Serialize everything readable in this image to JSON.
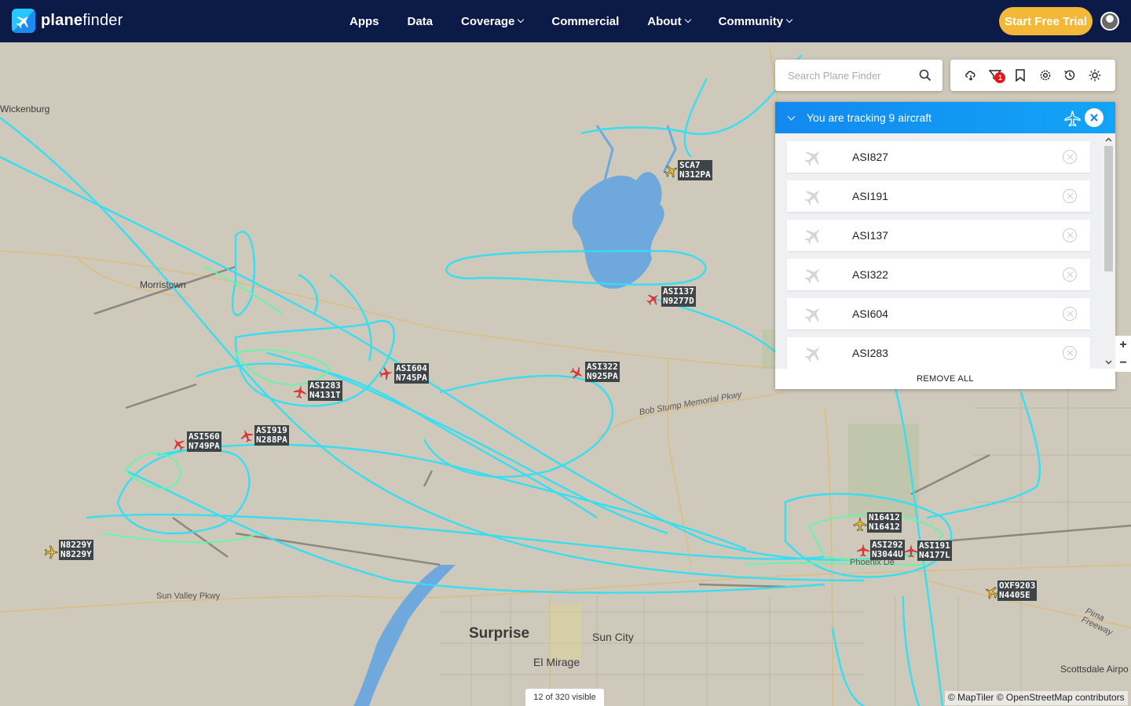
{
  "brand": {
    "name_bold": "plane",
    "name_light": "finder"
  },
  "nav": {
    "items": [
      {
        "label": "Apps",
        "dropdown": false
      },
      {
        "label": "Data",
        "dropdown": false
      },
      {
        "label": "Coverage",
        "dropdown": true
      },
      {
        "label": "Commercial",
        "dropdown": false
      },
      {
        "label": "About",
        "dropdown": true
      },
      {
        "label": "Community",
        "dropdown": true
      }
    ],
    "cta_label": "Start Free Trial"
  },
  "colors": {
    "nav_bg": "#0b1a47",
    "cta": "#f4b838",
    "track": "#2fe0f5",
    "track_alt": "#66f5a8",
    "panel_header": "#1289f0",
    "plane_red": "#d23a3a",
    "plane_yellow": "#f2c21c"
  },
  "search": {
    "placeholder": "Search Plane Finder",
    "icon": "search-icon"
  },
  "toolbar": {
    "icons": [
      "weather-icon",
      "filter-icon",
      "bookmark-icon",
      "settings-icon",
      "history-icon",
      "sun-icon"
    ],
    "filter_badge": "1"
  },
  "tracking": {
    "header": "You are tracking 9 aircraft",
    "remove_all_label": "REMOVE ALL",
    "items": [
      {
        "label": "ASI827"
      },
      {
        "label": "ASI191"
      },
      {
        "label": "ASI137"
      },
      {
        "label": "ASI322"
      },
      {
        "label": "ASI604"
      },
      {
        "label": "ASI283"
      }
    ]
  },
  "aircraft": [
    {
      "line1": "SCA7",
      "line2": "N312PA",
      "color": "yellow"
    },
    {
      "line1": "ASI137",
      "line2": "N9277D",
      "color": "red"
    },
    {
      "line1": "ASI604",
      "line2": "N745PA",
      "color": "red"
    },
    {
      "line1": "ASI322",
      "line2": "N925PA",
      "color": "red"
    },
    {
      "line1": "ASI283",
      "line2": "N4131T",
      "color": "red"
    },
    {
      "line1": "ASI919",
      "line2": "N288PA",
      "color": "red"
    },
    {
      "line1": "ASI560",
      "line2": "N749PA",
      "color": "red"
    },
    {
      "line1": "N8229Y",
      "line2": "N8229Y",
      "color": "yellow"
    },
    {
      "line1": "N16412",
      "line2": "N16412",
      "color": "yellow"
    },
    {
      "line1": "ASI292",
      "line2": "N3044U",
      "color": "red"
    },
    {
      "line1": "ASI191",
      "line2": "N4177L",
      "color": "red"
    },
    {
      "line1": "OXF9203",
      "line2": "N4405E",
      "color": "yellow"
    }
  ],
  "places": [
    {
      "name": "Wickenburg"
    },
    {
      "name": "Morristown"
    },
    {
      "name": "Surprise"
    },
    {
      "name": "Sun City"
    },
    {
      "name": "El Mirage"
    },
    {
      "name": "Scottsdale Airpo"
    },
    {
      "name": "Sun Valley Pkwy"
    },
    {
      "name": "Bob Stump Memorial Pkwy"
    },
    {
      "name": "Pima Freeway"
    },
    {
      "name": "Phoenix De"
    }
  ],
  "status": {
    "visible": "12 of 320 visible",
    "attribution": "© MapTiler © OpenStreetMap contributors"
  }
}
